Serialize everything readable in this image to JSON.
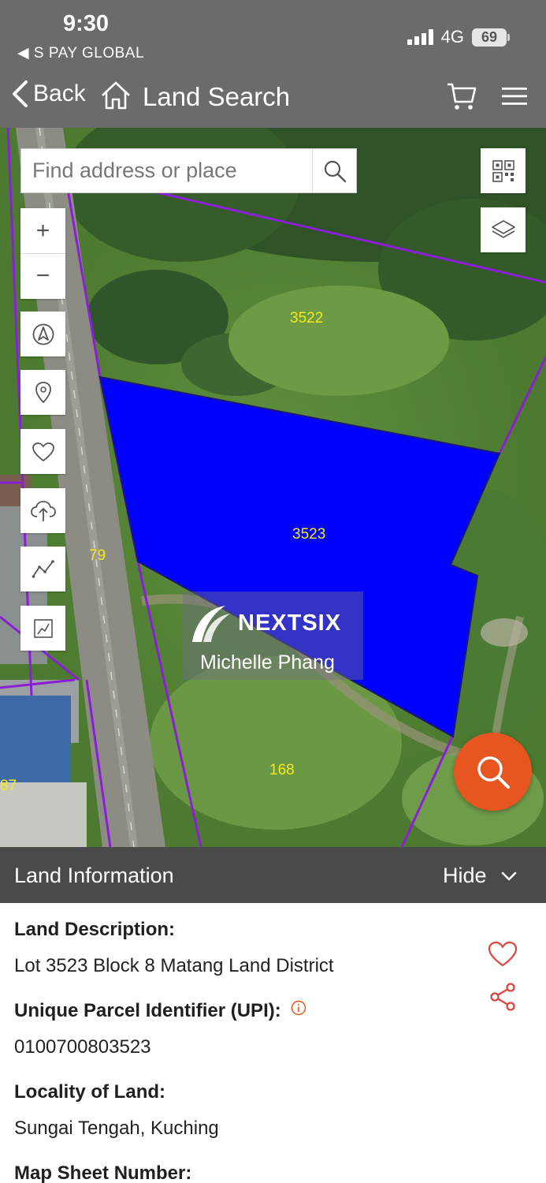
{
  "status_bar": {
    "time": "9:30",
    "back_app": "◀ S PAY GLOBAL",
    "network": "4G",
    "battery": "69"
  },
  "header": {
    "back_label": "Back",
    "title": "Land Search",
    "icons": [
      "home-icon",
      "cart-icon",
      "menu-icon"
    ]
  },
  "map": {
    "search_placeholder": "Find address or place",
    "controls": [
      "zoom-in-icon",
      "zoom-out-icon",
      "compass-icon",
      "location-pin-icon",
      "heart-icon",
      "upload-icon",
      "measure-icon",
      "draw-area-icon",
      "qr-icon",
      "layers-icon"
    ],
    "zoom_in": "+",
    "zoom_out": "−",
    "parcel_labels": {
      "p3522": "3522",
      "p3523": "3523",
      "p79": "79",
      "p168": "168",
      "p87": "87"
    },
    "selected_parcel_color": "#0000ff",
    "boundary_color": "#8a1fd6",
    "watermark": {
      "brand": "NEXTSIX",
      "name": "Michelle Phang"
    },
    "fab_color": "#e75521"
  },
  "info_panel": {
    "title": "Land Information",
    "hide_label": "Hide",
    "land_description_label": "Land Description:",
    "land_description": "Lot 3523 Block 8 Matang Land District",
    "upi_label": "Unique Parcel Identifier (UPI):",
    "upi": "0100700803523",
    "locality_label": "Locality of Land:",
    "locality": "Sungai Tengah, Kuching",
    "map_sheet_label": "Map Sheet Number:"
  }
}
